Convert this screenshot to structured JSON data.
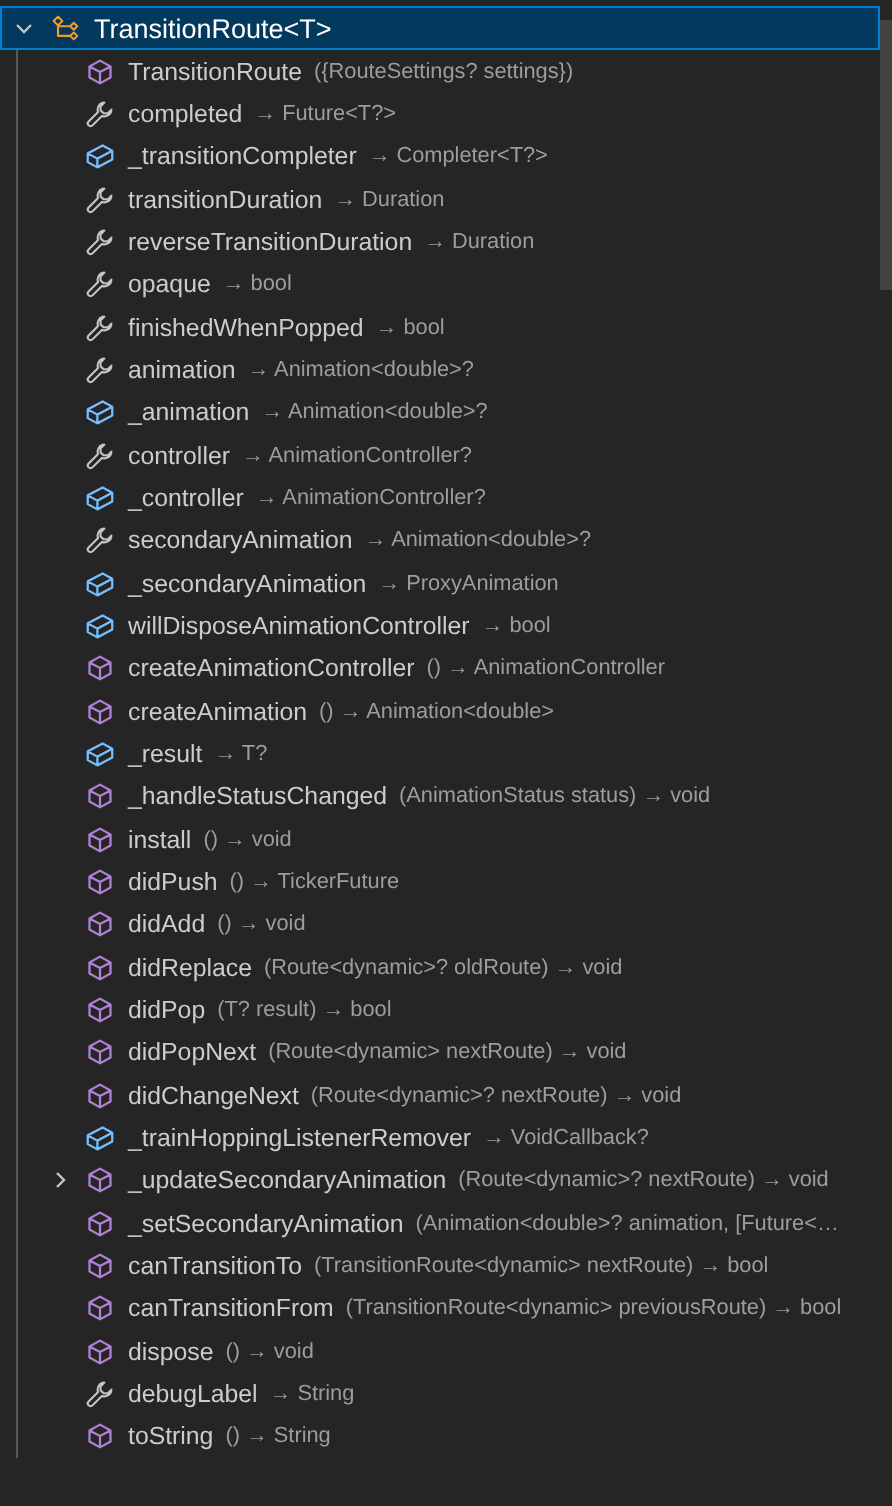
{
  "outline": {
    "root": {
      "kind": "class",
      "name": "TransitionRoute<T>",
      "selected": true,
      "expanded": true,
      "children": [
        {
          "kind": "method",
          "name": "TransitionRoute",
          "detail": "({RouteSettings? settings})"
        },
        {
          "kind": "property",
          "name": "completed",
          "detail": "→ Future<T?>"
        },
        {
          "kind": "field",
          "name": "_transitionCompleter",
          "detail": "→ Completer<T?>"
        },
        {
          "kind": "property",
          "name": "transitionDuration",
          "detail": "→ Duration"
        },
        {
          "kind": "property",
          "name": "reverseTransitionDuration",
          "detail": "→ Duration"
        },
        {
          "kind": "property",
          "name": "opaque",
          "detail": "→ bool"
        },
        {
          "kind": "property",
          "name": "finishedWhenPopped",
          "detail": "→ bool"
        },
        {
          "kind": "property",
          "name": "animation",
          "detail": "→ Animation<double>?"
        },
        {
          "kind": "field",
          "name": "_animation",
          "detail": "→ Animation<double>?"
        },
        {
          "kind": "property",
          "name": "controller",
          "detail": "→ AnimationController?"
        },
        {
          "kind": "field",
          "name": "_controller",
          "detail": "→ AnimationController?"
        },
        {
          "kind": "property",
          "name": "secondaryAnimation",
          "detail": "→ Animation<double>?"
        },
        {
          "kind": "field",
          "name": "_secondaryAnimation",
          "detail": "→ ProxyAnimation"
        },
        {
          "kind": "field",
          "name": "willDisposeAnimationController",
          "detail": "→ bool"
        },
        {
          "kind": "method",
          "name": "createAnimationController",
          "detail": "() → AnimationController"
        },
        {
          "kind": "method",
          "name": "createAnimation",
          "detail": "() → Animation<double>"
        },
        {
          "kind": "field",
          "name": "_result",
          "detail": "→ T?"
        },
        {
          "kind": "method",
          "name": "_handleStatusChanged",
          "detail": "(AnimationStatus status) → void"
        },
        {
          "kind": "method",
          "name": "install",
          "detail": "() → void"
        },
        {
          "kind": "method",
          "name": "didPush",
          "detail": "() → TickerFuture"
        },
        {
          "kind": "method",
          "name": "didAdd",
          "detail": "() → void"
        },
        {
          "kind": "method",
          "name": "didReplace",
          "detail": "(Route<dynamic>? oldRoute) → void"
        },
        {
          "kind": "method",
          "name": "didPop",
          "detail": "(T? result) → bool"
        },
        {
          "kind": "method",
          "name": "didPopNext",
          "detail": "(Route<dynamic> nextRoute) → void"
        },
        {
          "kind": "method",
          "name": "didChangeNext",
          "detail": "(Route<dynamic>? nextRoute) → void"
        },
        {
          "kind": "field",
          "name": "_trainHoppingListenerRemover",
          "detail": "→ VoidCallback?"
        },
        {
          "kind": "method",
          "name": "_updateSecondaryAnimation",
          "detail": "(Route<dynamic>? nextRoute) → void",
          "expanded": false
        },
        {
          "kind": "method",
          "name": "_setSecondaryAnimation",
          "detail": "(Animation<double>? animation, [Future<…"
        },
        {
          "kind": "method",
          "name": "canTransitionTo",
          "detail": "(TransitionRoute<dynamic> nextRoute) → bool"
        },
        {
          "kind": "method",
          "name": "canTransitionFrom",
          "detail": "(TransitionRoute<dynamic> previousRoute) → bool"
        },
        {
          "kind": "method",
          "name": "dispose",
          "detail": "() → void"
        },
        {
          "kind": "property",
          "name": "debugLabel",
          "detail": "→ String"
        },
        {
          "kind": "method",
          "name": "toString",
          "detail": "() → String"
        }
      ]
    }
  }
}
